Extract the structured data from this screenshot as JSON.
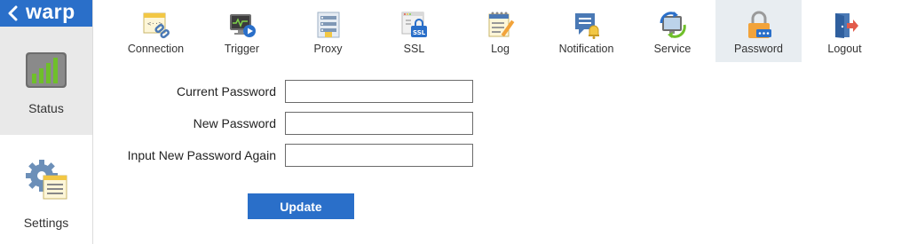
{
  "brand": {
    "back_icon": "chevron-left-icon",
    "name": "warp"
  },
  "sidebar": {
    "items": [
      {
        "label": "Status",
        "icon": "bar-chart-icon",
        "active": true
      },
      {
        "label": "Settings",
        "icon": "gear-document-icon",
        "active": false
      }
    ]
  },
  "toolbar": {
    "items": [
      {
        "label": "Connection",
        "icon": "link-document-icon"
      },
      {
        "label": "Trigger",
        "icon": "monitor-play-icon"
      },
      {
        "label": "Proxy",
        "icon": "server-list-icon"
      },
      {
        "label": "SSL",
        "icon": "ssl-lock-icon"
      },
      {
        "label": "Log",
        "icon": "notebook-pencil-icon"
      },
      {
        "label": "Notification",
        "icon": "speech-bubble-bell-icon"
      },
      {
        "label": "Service",
        "icon": "monitor-refresh-icon"
      },
      {
        "label": "Password",
        "icon": "padlock-icon",
        "active": true
      },
      {
        "label": "Logout",
        "icon": "door-exit-icon"
      }
    ]
  },
  "form": {
    "current_password_label": "Current Password",
    "current_password_value": "",
    "new_password_label": "New Password",
    "new_password_value": "",
    "confirm_password_label": "Input New Password Again",
    "confirm_password_value": "",
    "submit_label": "Update"
  },
  "colors": {
    "accent": "#2a6fc9",
    "active_tab_bg": "#e8edf1",
    "sidebar_active_bg": "#e9e9e9"
  }
}
